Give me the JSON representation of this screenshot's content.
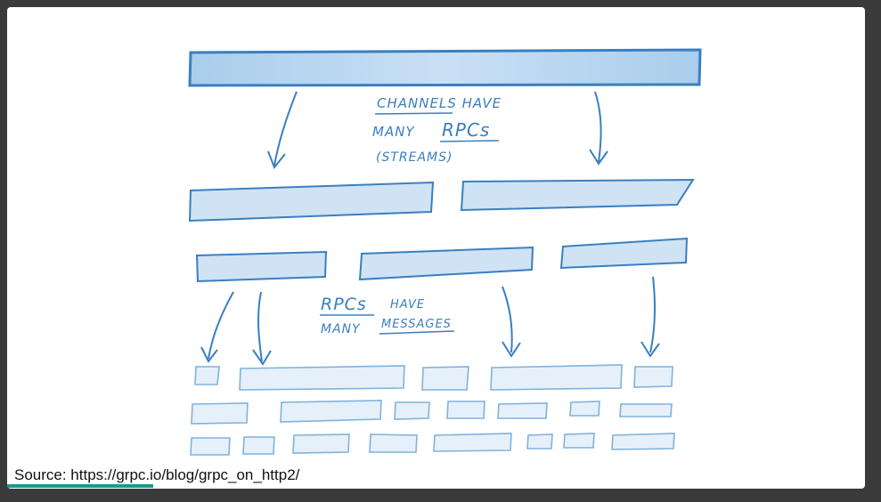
{
  "diagram": {
    "channel_note": {
      "line1": "CHANNELS HAVE",
      "line2_a": "MANY",
      "line2_b": "RPCs",
      "line3": "(STREAMS)"
    },
    "rpc_note": {
      "line1_a": "RPCs",
      "line1_b": "HAVE",
      "line2_a": "MANY",
      "line2_b": "MESSAGES"
    },
    "stroke_color": "#3a7fc0",
    "fill_color": "#cfe3f5"
  },
  "footer": {
    "source": "Source: https://grpc.io/blog/grpc_on_http2/"
  },
  "progress": {
    "fraction": 0.17,
    "color": "#1a9a8a"
  }
}
